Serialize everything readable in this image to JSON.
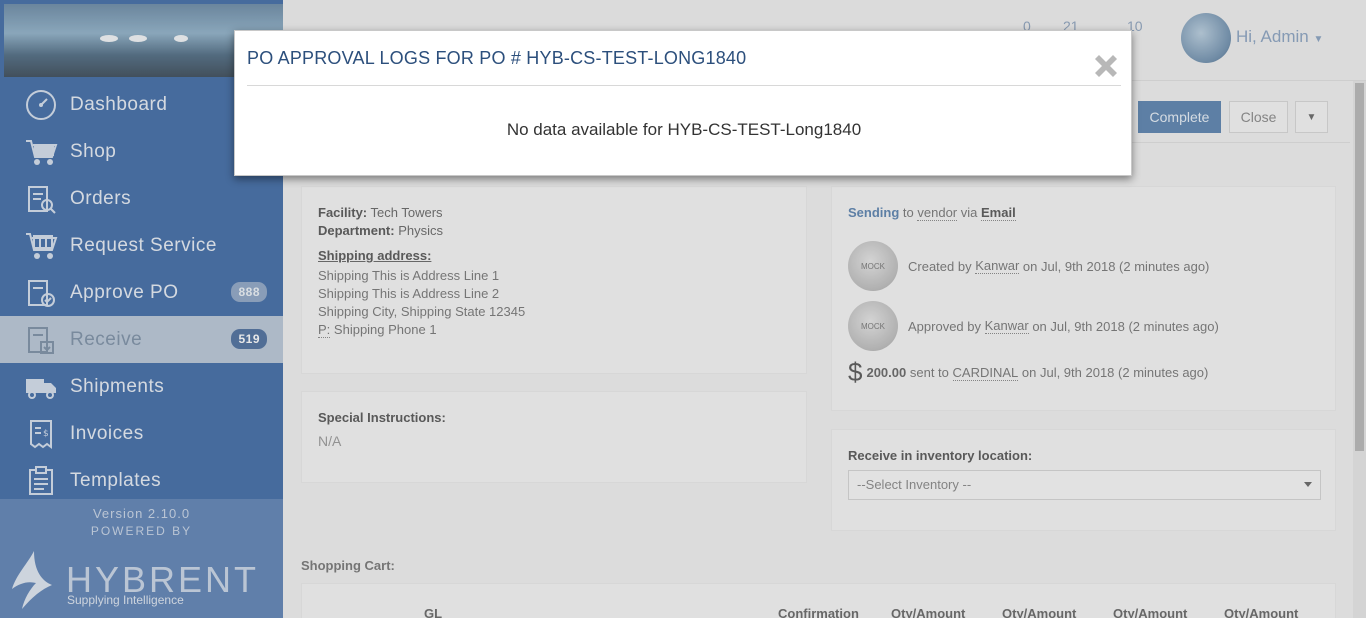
{
  "sidebar": {
    "items": [
      {
        "label": "Dashboard",
        "icon": "dashboard-icon"
      },
      {
        "label": "Shop",
        "icon": "cart-icon"
      },
      {
        "label": "Orders",
        "icon": "orders-icon"
      },
      {
        "label": "Request Service",
        "icon": "request-service-icon"
      },
      {
        "label": "Approve PO",
        "icon": "approve-po-icon",
        "badge": "888"
      },
      {
        "label": "Receive",
        "icon": "receive-icon",
        "badge": "519",
        "active": true
      },
      {
        "label": "Shipments",
        "icon": "truck-icon"
      },
      {
        "label": "Invoices",
        "icon": "invoice-icon"
      },
      {
        "label": "Templates",
        "icon": "templates-icon"
      }
    ],
    "version": "Version 2.10.0",
    "powered_by": "POWERED BY",
    "brand": "HYBRENT",
    "tagline": "Supplying Intelligence"
  },
  "header": {
    "stats": [
      "0",
      "21",
      "10"
    ],
    "user_greeting": "Hi, Admin"
  },
  "actions": {
    "complete_label": "Complete",
    "close_label": "Close"
  },
  "order": {
    "facility_label": "Facility:",
    "facility": "Tech Towers",
    "department_label": "Department:",
    "department": "Physics",
    "shipping_label": "Shipping address:",
    "address_lines": [
      "Shipping This is Address Line 1",
      "Shipping This is Address Line 2",
      "Shipping City, Shipping State 12345"
    ],
    "phone_prefix": "P:",
    "phone": "Shipping Phone 1",
    "special_label": "Special Instructions:",
    "special_value": "N/A"
  },
  "status": {
    "sending": "Sending",
    "to": "to",
    "vendor": "vendor",
    "via": "via",
    "channel": "Email",
    "logs": [
      {
        "pre": "Created by",
        "user": "Kanwar",
        "post": "on Jul, 9th 2018 (2 minutes ago)"
      },
      {
        "pre": "Approved by",
        "user": "Kanwar",
        "post": "on Jul, 9th 2018 (2 minutes ago)"
      }
    ],
    "payment_symbol": "$",
    "amount": "200.00",
    "sent_to": "sent to",
    "payee": "CARDINAL",
    "payment_post": "on Jul, 9th 2018 (2 minutes ago)",
    "avatar_text": "MOCK"
  },
  "inventory": {
    "label": "Receive in inventory location:",
    "placeholder": "--Select Inventory --"
  },
  "cart": {
    "title": "Shopping Cart:",
    "columns": [
      "GL",
      "Confirmation",
      "Qty/Amount",
      "Qty/Amount",
      "Qty/Amount",
      "Qty/Amount"
    ]
  },
  "modal": {
    "title": "PO APPROVAL LOGS FOR PO # HYB-CS-TEST-LONG1840",
    "message": "No data available for HYB-CS-TEST-Long1840"
  },
  "colors": {
    "sidebar": "#3e6aa6",
    "accent": "#5a82b0",
    "modal_title": "#2c4f7c"
  }
}
